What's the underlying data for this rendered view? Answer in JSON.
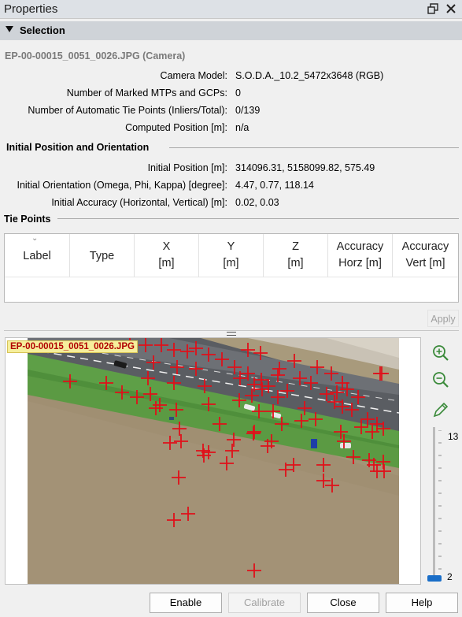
{
  "window": {
    "title": "Properties",
    "float_icon": "float-icon",
    "close_icon": "close-icon"
  },
  "selection": {
    "header": "Selection",
    "camera_title": "EP-00-00015_0051_0026.JPG (Camera)",
    "camera_model_label": "Camera Model:",
    "camera_model_value": "S.O.D.A._10.2_5472x3648 (RGB)",
    "marked_label": "Number of Marked MTPs and GCPs:",
    "marked_value": "0",
    "auto_tie_label": "Number of Automatic Tie Points (Inliers/Total):",
    "auto_tie_value": "0/139",
    "computed_pos_label": "Computed Position [m]:",
    "computed_pos_value": "n/a"
  },
  "initial": {
    "header": "Initial Position and Orientation",
    "position_label": "Initial Position [m]:",
    "position_value": "314096.31, 5158099.82, 575.49",
    "orientation_label": "Initial Orientation (Omega, Phi, Kappa) [degree]:",
    "orientation_value": "4.47, 0.77, 118.14",
    "accuracy_label": "Initial Accuracy (Horizontal, Vertical) [m]:",
    "accuracy_value": "0.02, 0.03"
  },
  "tie_points": {
    "header": "Tie Points",
    "columns": [
      {
        "line1": "Label",
        "line2": ""
      },
      {
        "line1": "Type",
        "line2": ""
      },
      {
        "line1": "X",
        "line2": "[m]"
      },
      {
        "line1": "Y",
        "line2": "[m]"
      },
      {
        "line1": "Z",
        "line2": "[m]"
      },
      {
        "line1": "Accuracy",
        "line2": "Horz [m]"
      },
      {
        "line1": "Accuracy",
        "line2": "Vert [m]"
      }
    ],
    "apply_label": "Apply"
  },
  "viewer": {
    "image_label": "EP-00-00015_0051_0026.JPG",
    "zoom_max": "13",
    "zoom_min": "2",
    "zoom_level_fraction": 0.0,
    "tools": [
      "zoom-in-icon",
      "zoom-out-icon",
      "pencil-icon"
    ]
  },
  "footer": {
    "enable": "Enable",
    "calibrate": "Calibrate",
    "close": "Close",
    "help": "Help"
  },
  "colors": {
    "accent": "#1a6ec8",
    "tie_point": "#e0101a",
    "label_bg": "#f6ef9c",
    "label_text": "#b10000"
  }
}
